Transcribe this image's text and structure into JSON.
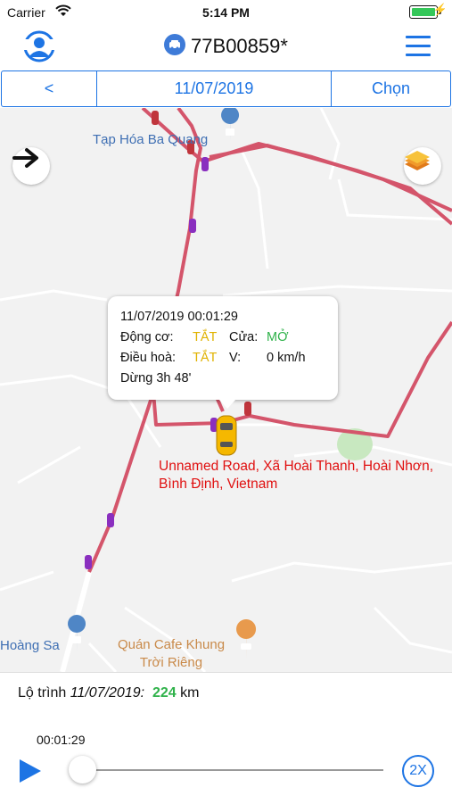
{
  "status": {
    "carrier": "Carrier",
    "time": "5:14 PM"
  },
  "header": {
    "vehicle_plate": "77B00859*"
  },
  "datebar": {
    "prev_label": "<",
    "date": "11/07/2019",
    "choose_label": "Chọn"
  },
  "map": {
    "pois": [
      {
        "name": "Tạp Hóa Ba Quang"
      },
      {
        "name": "Hoàng Sa"
      },
      {
        "name": "Quán Cafe Khung\nTrời Riêng"
      }
    ],
    "popup": {
      "datetime": "11/07/2019 00:01:29",
      "engine_label": "Động cơ:",
      "engine_value": "TẮT",
      "door_label": "Cửa:",
      "door_value": "MỞ",
      "ac_label": "Điều hoà:",
      "ac_value": "TẮT",
      "speed_label": "V:",
      "speed_value": "0 km/h",
      "stop_text": "Dừng 3h 48'"
    },
    "address": "Unnamed Road, Xã Hoài Thanh, Hoài Nhơn, Bình Định, Vietnam",
    "colors": {
      "route": "#d4556b",
      "address": "#e01010",
      "accent": "#1d74e4"
    }
  },
  "bottom": {
    "route_label": "Lộ trình",
    "route_date": "11/07/2019:",
    "distance": "224",
    "distance_unit": "km",
    "elapsed": "00:01:29",
    "playback_progress": 0.0,
    "speed_label": "2X"
  }
}
